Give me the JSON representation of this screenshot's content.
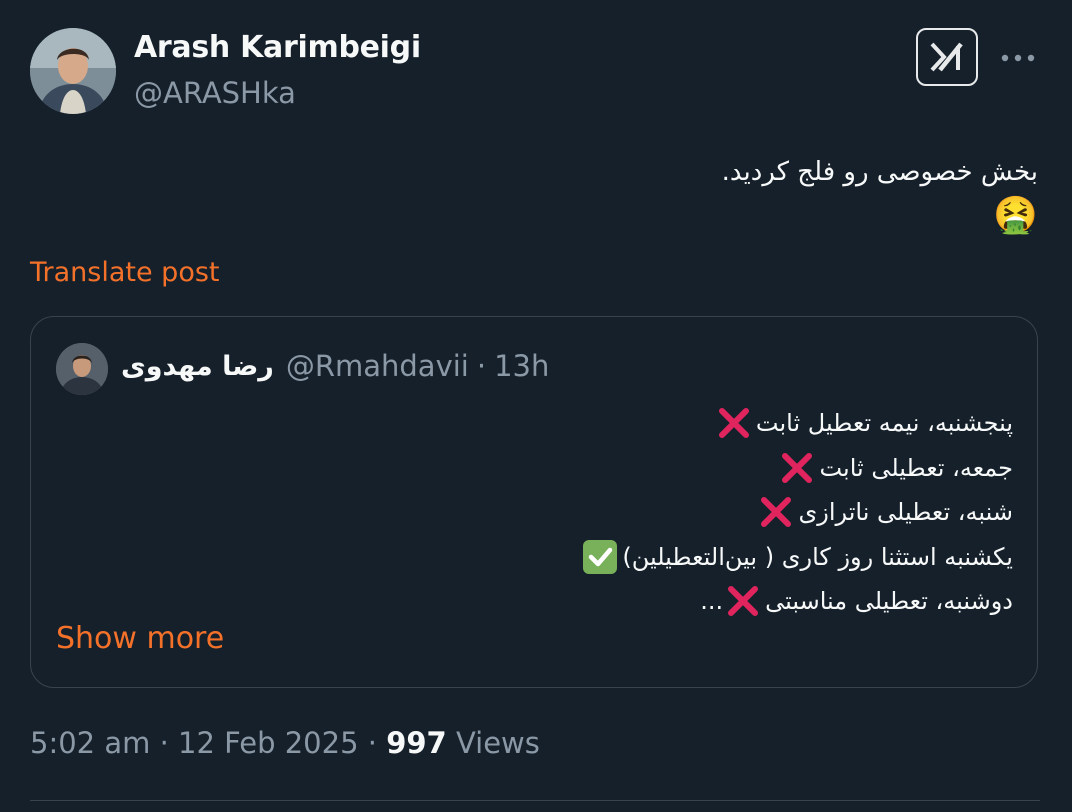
{
  "author": {
    "name": "Arash Karimbeigi",
    "handle": "@ARASHka"
  },
  "tweet": {
    "text_line1": "بخش خصوصی رو فلج کردید.",
    "emoji": "🤮"
  },
  "translate_label": "Translate post",
  "quote": {
    "name": "رضا مهدوی",
    "handle": "@Rmahdavii",
    "separator": "·",
    "time": "13h",
    "lines": [
      {
        "text": "پنجشنبه، نیمه تعطیل ثابت",
        "mark": "cross"
      },
      {
        "text": "جمعه، تعطیلی ثابت",
        "mark": "cross"
      },
      {
        "text": "شنبه، تعطیلی ناترازی",
        "mark": "cross"
      },
      {
        "text": "یکشنبه استثنا روز کاری ( بین‌التعطیلین)",
        "mark": "check"
      },
      {
        "text": "دوشنبه، تعطیلی مناسبتی",
        "mark": "cross",
        "suffix": "..."
      }
    ],
    "show_more_label": "Show more"
  },
  "meta": {
    "time": "5:02 am",
    "sep1": "·",
    "date": "12 Feb 2025",
    "sep2": "·",
    "views_count": "997",
    "views_label": "Views"
  },
  "colors": {
    "background": "#15202b",
    "accent": "#f4712a",
    "secondary_text": "#8b98a5",
    "cross": "#e0245e",
    "check": "#78b159"
  },
  "icons": {
    "grok": "grok-icon",
    "more": "more-horizontal-icon",
    "cross": "cross-mark-icon",
    "check": "check-mark-button-icon"
  }
}
